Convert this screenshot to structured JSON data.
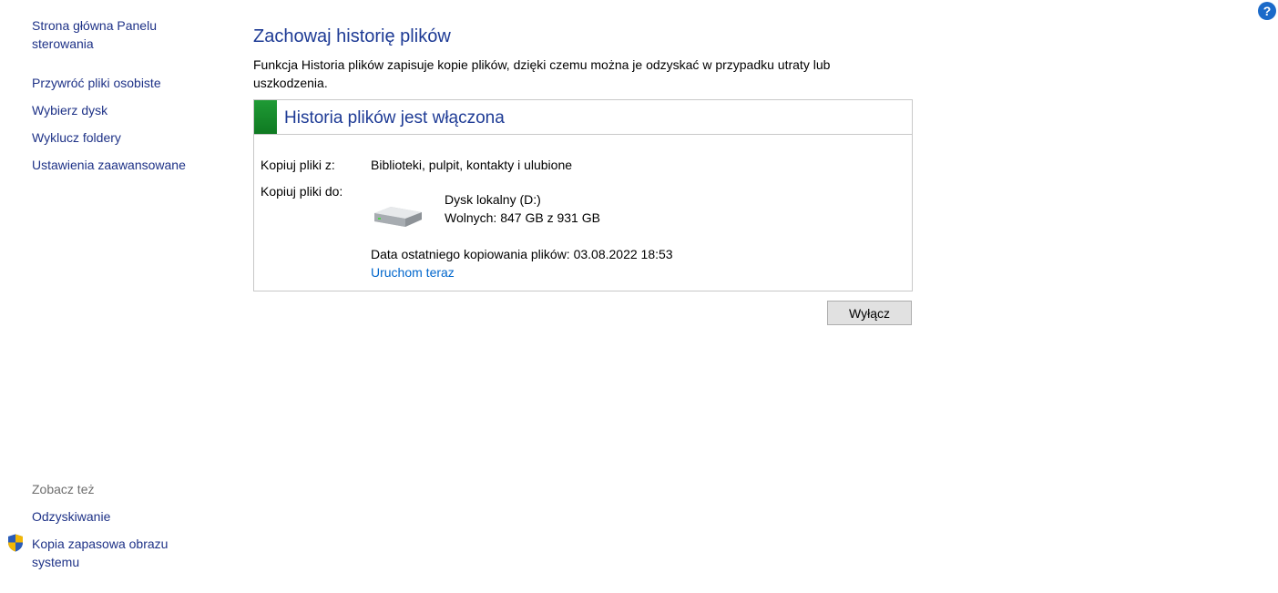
{
  "sidebar": {
    "home_link": [
      "Strona główna Panelu",
      "sterowania"
    ],
    "links": [
      "Przywróć pliki osobiste",
      "Wybierz dysk",
      "Wyklucz foldery",
      "Ustawienia zaawansowane"
    ],
    "see_also_label": "Zobacz też",
    "see_also_links": {
      "recovery": "Odzyskiwanie",
      "system_image": [
        "Kopia zapasowa obrazu",
        "systemu"
      ]
    }
  },
  "help_icon": {
    "label": "?",
    "color": "#1b6ac9"
  },
  "main": {
    "title": "Zachowaj historię plików",
    "description": [
      "Funkcja Historia plików zapisuje kopie plików, dzięki czemu można je odzyskać w przypadku utraty lub",
      "uszkodzenia."
    ],
    "status": {
      "title": "Historia plików jest włączona",
      "accent_color": "#1a8f30",
      "copy_from_label": "Kopiuj pliki z:",
      "copy_from_value": "Biblioteki, pulpit, kontakty i ulubione",
      "copy_to_label": "Kopiuj pliki do:",
      "drive_name": "Dysk lokalny (D:)",
      "drive_free": "Wolnych: 847 GB z 931 GB",
      "last_copy": "Data ostatniego kopiowania plików: 03.08.2022 18:53",
      "run_now": "Uruchom teraz"
    },
    "turn_off_button": "Wyłącz"
  }
}
